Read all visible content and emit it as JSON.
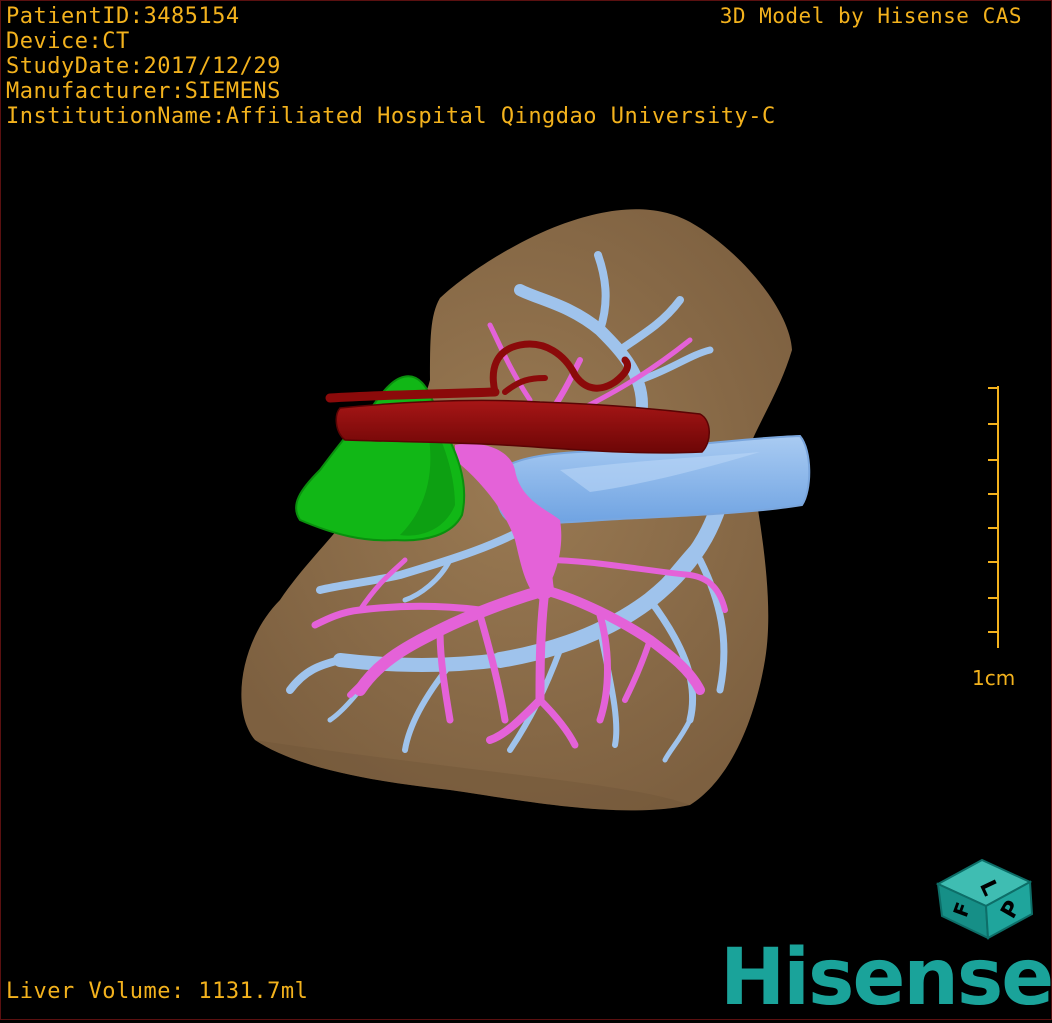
{
  "header": {
    "patient_id": "PatientID:3485154",
    "device": "Device:CT",
    "study_date": "StudyDate:2017/12/29",
    "manufacturer": "Manufacturer:SIEMENS",
    "institution": "InstitutionName:Affiliated Hospital Qingdao University-C",
    "brand_caption": "3D Model by Hisense CAS"
  },
  "footer": {
    "liver_volume": "Liver Volume: 1131.7ml"
  },
  "scale_bar": {
    "label": "1cm"
  },
  "orientation_cube": {
    "face_top": "L",
    "face_front": "P",
    "face_side": "F",
    "color": "#1aa39a"
  },
  "logo": {
    "text": "Hisense"
  },
  "colors": {
    "text": "#f3b21d",
    "liver": "#8c6d48",
    "artery": "#8b0a0a",
    "portal_vein": "#e462d8",
    "hepatic_vein": "#9fc3ec",
    "gallbladder": "#11b716",
    "brand": "#1aa39a"
  }
}
